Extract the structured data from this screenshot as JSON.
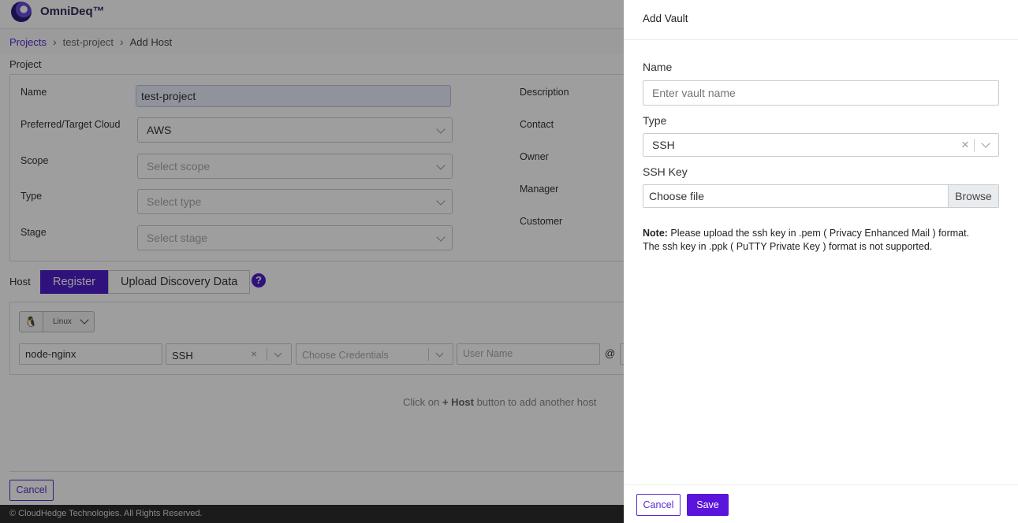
{
  "app": {
    "brand": "OmniDeq™"
  },
  "breadcrumb": {
    "items": [
      "Projects",
      "test-project",
      "Add Host"
    ]
  },
  "project": {
    "section_label": "Project",
    "fields": {
      "name": {
        "label": "Name",
        "value": "test-project"
      },
      "cloud": {
        "label": "Preferred/Target Cloud",
        "value": "AWS"
      },
      "scope": {
        "label": "Scope",
        "placeholder": "Select scope"
      },
      "type": {
        "label": "Type",
        "placeholder": "Select type"
      },
      "stage": {
        "label": "Stage",
        "placeholder": "Select stage"
      }
    },
    "right_labels": {
      "description": "Description",
      "contact": "Contact",
      "owner": "Owner",
      "manager": "Manager",
      "customer": "Customer"
    }
  },
  "host": {
    "section_label": "Host",
    "tabs": [
      "Register",
      "Upload Discovery Data"
    ],
    "help": "?",
    "os": {
      "icon": "linux-penguin-icon",
      "glyph": "🐧",
      "value": "Linux"
    },
    "row": {
      "hostname": "node-nginx",
      "connection_type": "SSH",
      "x": "×",
      "credentials_placeholder": "Choose Credentials",
      "username_placeholder": "User Name",
      "at": "@"
    },
    "hint_pre": "Click on ",
    "hint_bold": "+ Host",
    "hint_post": " button to add another host"
  },
  "page_footer": {
    "cancel": "Cancel",
    "copyright": "© CloudHedge Technologies. All Rights Reserved."
  },
  "drawer": {
    "title": "Add Vault",
    "name_label": "Name",
    "name_placeholder": "Enter vault name",
    "type_label": "Type",
    "type_value": "SSH",
    "type_clear": "×",
    "sshkey_label": "SSH Key",
    "file_text": "Choose file",
    "browse": "Browse",
    "note_bold": "Note:",
    "note_text": " Please upload the ssh key in .pem ( Privacy Enhanced Mail ) format. The ssh key in .ppk ( PuTTY Private Key ) format is not supported.",
    "cancel": "Cancel",
    "save": "Save"
  },
  "colors": {
    "accent": "#5a14dc",
    "footer_bg": "#2c2c2c",
    "overlay": "rgba(0,0,0,0.38)"
  }
}
